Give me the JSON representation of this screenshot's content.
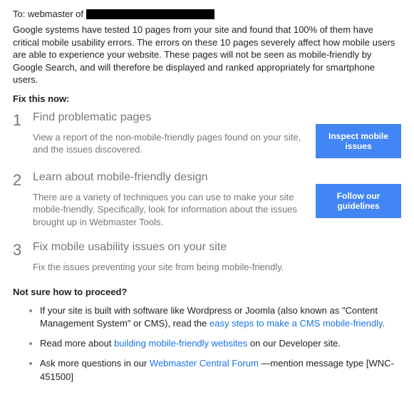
{
  "header": {
    "to_prefix": "To: webmaster of "
  },
  "intro": "Google systems have tested 10 pages from your site and found that 100% of them have critical mobile usability errors. The errors on these 10 pages severely affect how mobile users are able to experience your website. These pages will not be seen as mobile-friendly by Google Search, and will therefore be displayed and ranked appropriately for smartphone users.",
  "fix_heading": "Fix this now:",
  "steps": [
    {
      "num": "1",
      "title": "Find problematic pages",
      "desc": "View a report of the non-mobile-friendly pages found on your site, and the issues discovered.",
      "button": "Inspect mobile issues"
    },
    {
      "num": "2",
      "title": "Learn about mobile-friendly design",
      "desc": "There are a variety of techniques you can use to make your site mobile-friendly. Specifically, look for information about the issues brought up in Webmaster Tools.",
      "button": "Follow our guidelines"
    },
    {
      "num": "3",
      "title": "Fix mobile usability issues on your site",
      "desc": "Fix the issues preventing your site from being mobile-friendly."
    }
  ],
  "proceed_heading": "Not sure how to proceed?",
  "bullets": {
    "b1_a": "If your site is built with software like Wordpress or Joomla (also known as \"Content Management System\" or CMS), read the ",
    "b1_link": "easy steps to make a CMS mobile-friendly",
    "b1_b": ".",
    "b2_a": "Read more about ",
    "b2_link": "building mobile-friendly websites",
    "b2_b": " on our Developer site.",
    "b3_a": "Ask more questions in our ",
    "b3_link": "Webmaster Central Forum",
    "b3_b": " —mention message type [WNC-451500]"
  }
}
